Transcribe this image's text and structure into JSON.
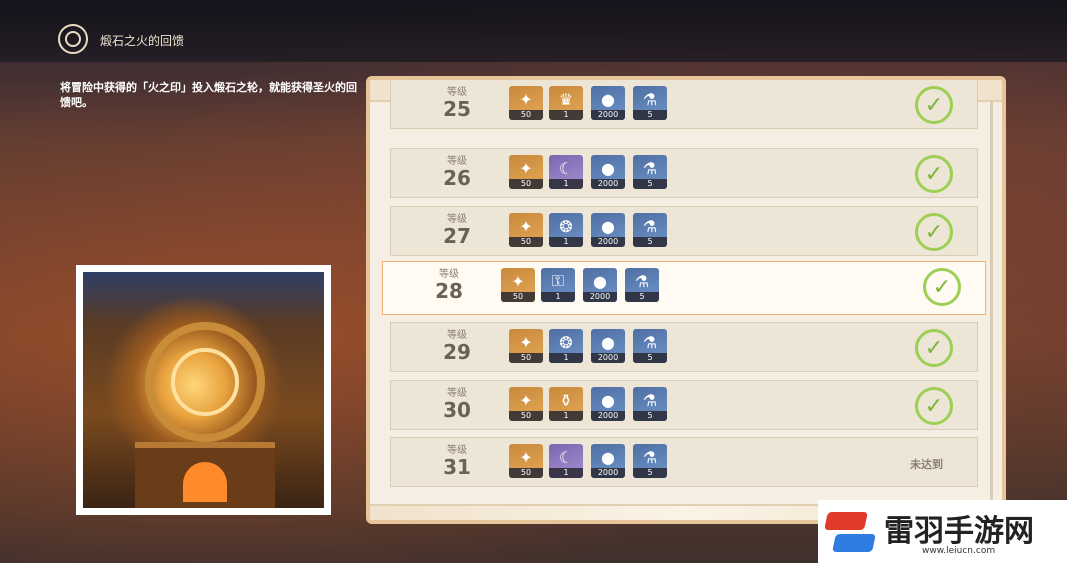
{
  "event": {
    "title": "煅石之火的回馈",
    "description": "将冒险中获得的「火之印」投入煅石之轮，就能获得圣火的回馈吧。"
  },
  "rewards": {
    "level_label": "等级",
    "rows": [
      {
        "level": "25",
        "status": "claimed",
        "items": [
          {
            "icon": "primogem-icon",
            "glyph": "✦",
            "qty": "50",
            "quality": "gold"
          },
          {
            "icon": "crown-icon",
            "glyph": "♛",
            "qty": "1",
            "quality": "gold"
          },
          {
            "icon": "mora-icon",
            "glyph": "●",
            "qty": "2000",
            "quality": "blue"
          },
          {
            "icon": "potion-icon",
            "glyph": "⚗",
            "qty": "5",
            "quality": "blue"
          }
        ]
      },
      {
        "level": "26",
        "status": "claimed",
        "items": [
          {
            "icon": "primogem-icon",
            "glyph": "✦",
            "qty": "50",
            "quality": "gold"
          },
          {
            "icon": "crescent-icon",
            "glyph": "☾",
            "qty": "1",
            "quality": "purple"
          },
          {
            "icon": "mora-icon",
            "glyph": "●",
            "qty": "2000",
            "quality": "blue"
          },
          {
            "icon": "potion-icon",
            "glyph": "⚗",
            "qty": "5",
            "quality": "blue"
          }
        ]
      },
      {
        "level": "27",
        "status": "claimed",
        "items": [
          {
            "icon": "primogem-icon",
            "glyph": "✦",
            "qty": "50",
            "quality": "gold"
          },
          {
            "icon": "ore-icon",
            "glyph": "❂",
            "qty": "1",
            "quality": "blue"
          },
          {
            "icon": "mora-icon",
            "glyph": "●",
            "qty": "2000",
            "quality": "blue"
          },
          {
            "icon": "potion-icon",
            "glyph": "⚗",
            "qty": "5",
            "quality": "blue"
          }
        ]
      },
      {
        "level": "28",
        "status": "claimed",
        "highlighted": true,
        "items": [
          {
            "icon": "primogem-icon",
            "glyph": "✦",
            "qty": "50",
            "quality": "gold"
          },
          {
            "icon": "key-icon",
            "glyph": "⚿",
            "qty": "1",
            "quality": "blue"
          },
          {
            "icon": "mora-icon",
            "glyph": "●",
            "qty": "2000",
            "quality": "blue"
          },
          {
            "icon": "potion-icon",
            "glyph": "⚗",
            "qty": "5",
            "quality": "blue"
          }
        ]
      },
      {
        "level": "29",
        "status": "claimed",
        "items": [
          {
            "icon": "primogem-icon",
            "glyph": "✦",
            "qty": "50",
            "quality": "gold"
          },
          {
            "icon": "ore-icon",
            "glyph": "❂",
            "qty": "1",
            "quality": "blue"
          },
          {
            "icon": "mora-icon",
            "glyph": "●",
            "qty": "2000",
            "quality": "blue"
          },
          {
            "icon": "potion-icon",
            "glyph": "⚗",
            "qty": "5",
            "quality": "blue"
          }
        ]
      },
      {
        "level": "30",
        "status": "claimed",
        "items": [
          {
            "icon": "primogem-icon",
            "glyph": "✦",
            "qty": "50",
            "quality": "gold"
          },
          {
            "icon": "flask-icon",
            "glyph": "⚱",
            "qty": "1",
            "quality": "gold"
          },
          {
            "icon": "mora-icon",
            "glyph": "●",
            "qty": "2000",
            "quality": "blue"
          },
          {
            "icon": "potion-icon",
            "glyph": "⚗",
            "qty": "5",
            "quality": "blue"
          }
        ]
      },
      {
        "level": "31",
        "status": "locked",
        "status_text": "未达到",
        "items": [
          {
            "icon": "primogem-icon",
            "glyph": "✦",
            "qty": "50",
            "quality": "gold"
          },
          {
            "icon": "crescent-icon",
            "glyph": "☾",
            "qty": "1",
            "quality": "purple"
          },
          {
            "icon": "mora-icon",
            "glyph": "●",
            "qty": "2000",
            "quality": "blue"
          },
          {
            "icon": "potion-icon",
            "glyph": "⚗",
            "qty": "5",
            "quality": "blue"
          }
        ]
      }
    ]
  },
  "watermark": {
    "name": "雷羽手游网",
    "url": "www.leiucn.com"
  }
}
